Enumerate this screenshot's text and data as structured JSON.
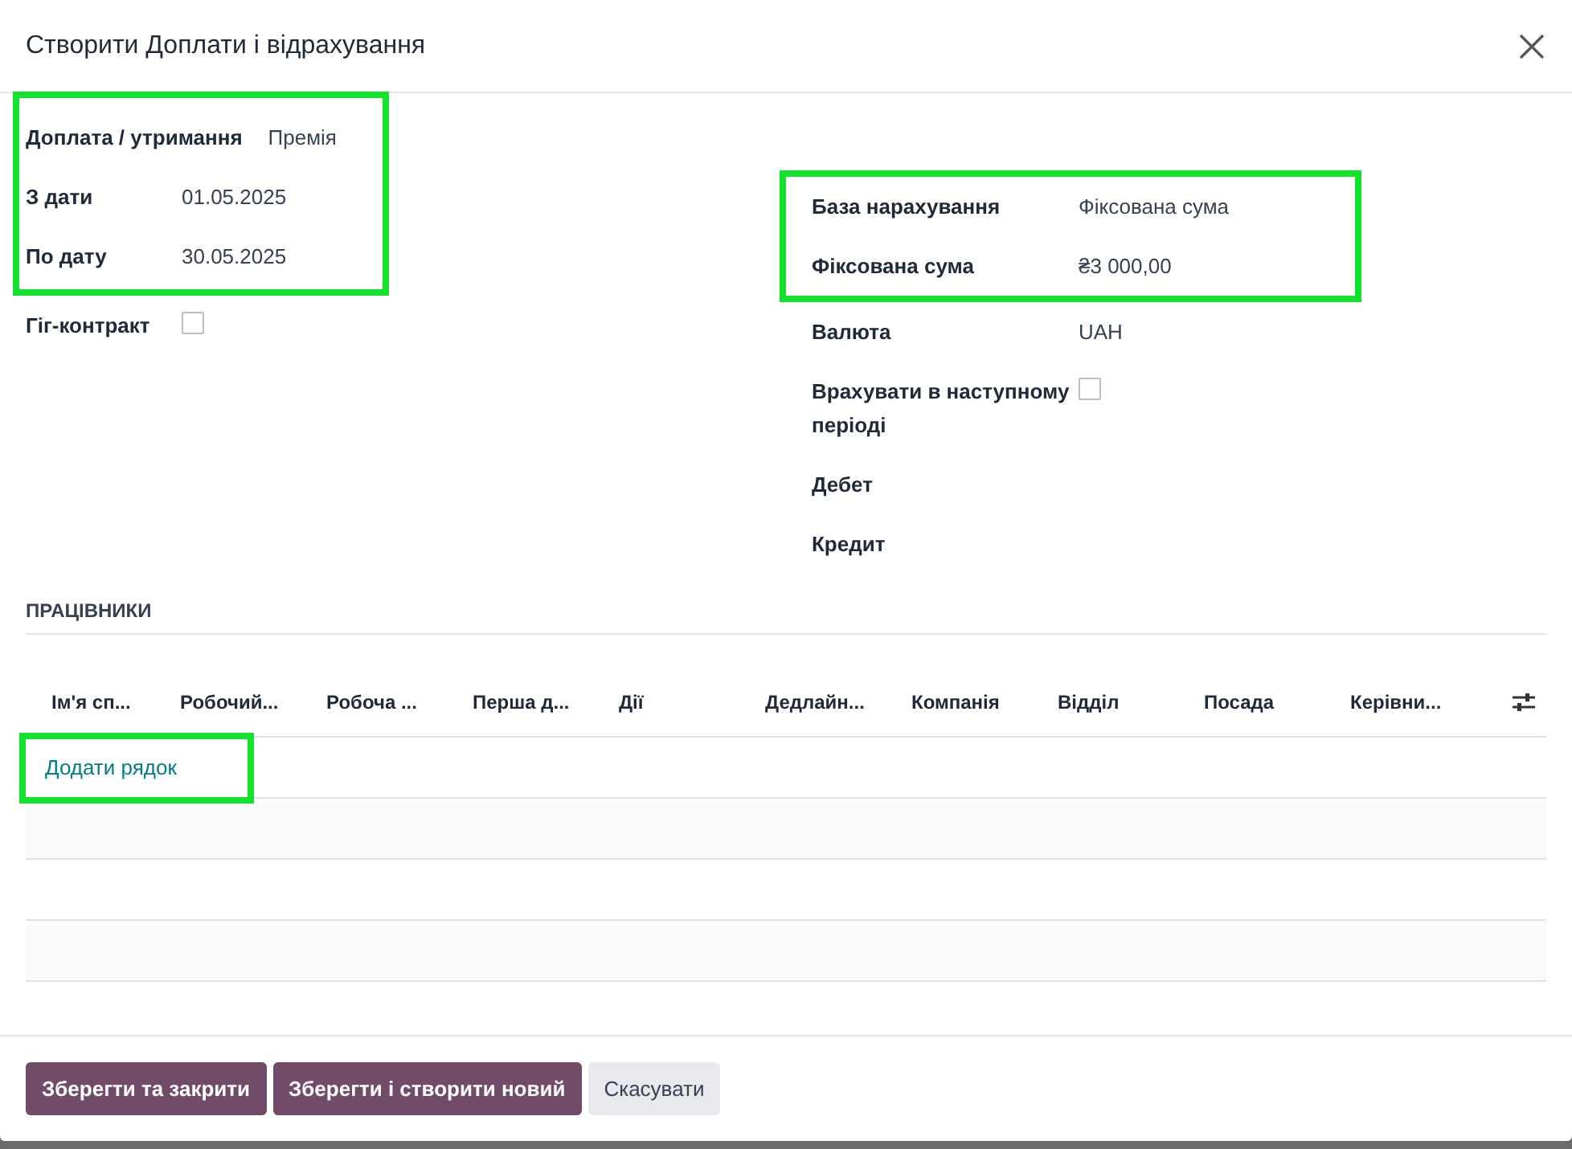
{
  "dialog": {
    "title": "Створити Доплати і відрахування"
  },
  "left": [
    {
      "highlighted": true,
      "fields": [
        {
          "kind": "text",
          "label": "Доплата / утримання",
          "value": "Премія"
        },
        {
          "kind": "text",
          "label": "З дати",
          "value": "01.05.2025"
        },
        {
          "kind": "text",
          "label": "По дату",
          "value": "30.05.2025"
        }
      ]
    },
    {
      "highlighted": false,
      "fields": [
        {
          "kind": "checkbox",
          "label": "Гіг-контракт",
          "checked": false
        }
      ]
    }
  ],
  "right": [
    {
      "highlighted": true,
      "fields": [
        {
          "kind": "text",
          "label": "База нарахування",
          "value": "Фіксована сума"
        },
        {
          "kind": "text",
          "label": "Фіксована сума",
          "value": "₴3 000,00"
        }
      ]
    },
    {
      "highlighted": false,
      "fields": [
        {
          "kind": "text",
          "label": "Валюта",
          "value": "UAH"
        },
        {
          "kind": "checkbox",
          "label": "Врахувати в наступному періоді",
          "checked": false
        },
        {
          "kind": "text",
          "label": "Дебет"
        },
        {
          "kind": "text",
          "label": "Кредит"
        }
      ]
    }
  ],
  "employees": {
    "title": "ПРАЦІВНИКИ",
    "columns": [
      "Ім'я сп...",
      "Робочий...",
      "Робоча ...",
      "Перша д...",
      "Дії",
      "Дедлайн...",
      "Компанія",
      "Відділ",
      "Посада",
      "Керівни..."
    ],
    "add_line": {
      "label": "Додати рядок",
      "highlighted": true
    }
  },
  "buttons": [
    {
      "label": "Зберегти та закрити",
      "kind": "primary"
    },
    {
      "label": "Зберегти і створити новий",
      "kind": "primary"
    },
    {
      "label": "Скасувати",
      "kind": "secondary"
    }
  ]
}
